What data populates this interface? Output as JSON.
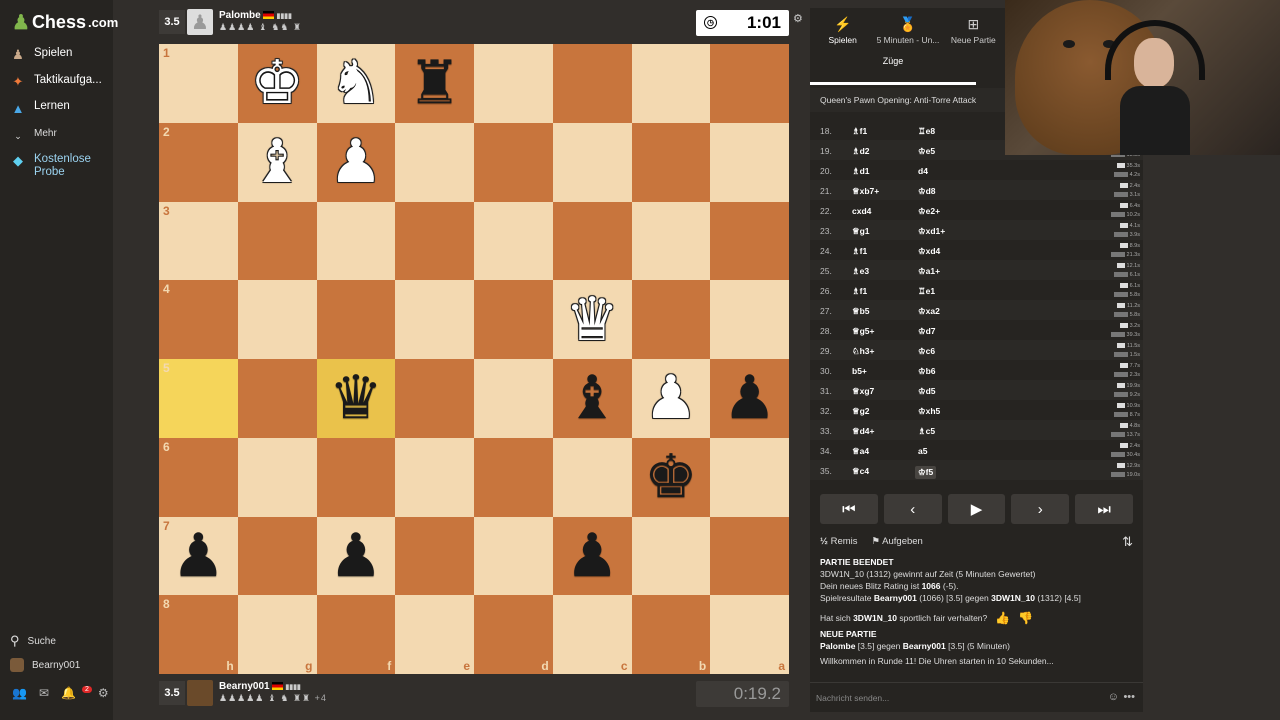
{
  "sidebar": {
    "logo": "Chess",
    "logo_suffix": ".com",
    "items": [
      {
        "label": "Spielen",
        "icon": "play-icon"
      },
      {
        "label": "Taktikaufga...",
        "icon": "puzzle-icon"
      },
      {
        "label": "Lernen",
        "icon": "learn-icon"
      },
      {
        "label": "Mehr",
        "icon": "chevron-down-icon"
      },
      {
        "label": "Kostenlose Probe",
        "icon": "diamond-icon"
      }
    ],
    "search_label": "Suche",
    "user_label": "Bearny001",
    "notification_count": "2"
  },
  "top_player": {
    "score": "3.5",
    "name": "Palombe",
    "captured": "♟♟♟♟ ♝ ♞♞ ♜",
    "clock": "1:01"
  },
  "bottom_player": {
    "score": "3.5",
    "name": "Bearny001",
    "captured": "♟♟♟♟♟ ♝ ♞ ♜♜",
    "material": "+4",
    "clock": "0:19.2"
  },
  "board": {
    "ranks": [
      "1",
      "2",
      "3",
      "4",
      "5",
      "6",
      "7",
      "8"
    ],
    "files": [
      "h",
      "g",
      "f",
      "e",
      "d",
      "c",
      "b",
      "a"
    ],
    "pieces": [
      [
        "",
        "wK",
        "wN",
        "bR",
        "",
        "",
        "",
        ""
      ],
      [
        "",
        "wB",
        "wP",
        "",
        "",
        "",
        "",
        ""
      ],
      [
        "",
        "",
        "",
        "",
        "",
        "",
        "",
        ""
      ],
      [
        "",
        "",
        "",
        "",
        "",
        "wQ",
        "",
        ""
      ],
      [
        "",
        "",
        "bQ",
        "",
        "",
        "bB",
        "wP",
        "bP"
      ],
      [
        "",
        "",
        "",
        "",
        "",
        "",
        "bK",
        ""
      ],
      [
        "bP",
        "",
        "bP",
        "",
        "",
        "bP",
        "",
        ""
      ],
      [
        "",
        "",
        "",
        "",
        "",
        "",
        "",
        ""
      ]
    ]
  },
  "panel": {
    "tabs": [
      {
        "label": "Spielen",
        "icon": "lightning-icon"
      },
      {
        "label": "5 Minuten - Un...",
        "icon": "medal-icon"
      },
      {
        "label": "Neue Partie",
        "icon": "plus-icon"
      }
    ],
    "subtab": "Züge",
    "opening": "Queen's Pawn Opening: Anti-Torre Attack",
    "moves": [
      {
        "no": "18.",
        "w": "♗f1",
        "b": "♖e8",
        "tw": "",
        "tb": ""
      },
      {
        "no": "19.",
        "w": "♗d2",
        "b": "♔e5",
        "tw": "5.6s",
        "tb": "15.8s"
      },
      {
        "no": "20.",
        "w": "♗d1",
        "b": "d4",
        "tw": "35.3s",
        "tb": "4.2s"
      },
      {
        "no": "21.",
        "w": "♕xb7+",
        "b": "♔d8",
        "tw": "2.4s",
        "tb": "3.1s"
      },
      {
        "no": "22.",
        "w": "cxd4",
        "b": "♔e2+",
        "tw": "6.4s",
        "tb": "10.2s"
      },
      {
        "no": "23.",
        "w": "♕g1",
        "b": "♔xd1+",
        "tw": "4.1s",
        "tb": "3.9s"
      },
      {
        "no": "24.",
        "w": "♗f1",
        "b": "♔xd4",
        "tw": "8.9s",
        "tb": "21.3s"
      },
      {
        "no": "25.",
        "w": "♗e3",
        "b": "♔a1+",
        "tw": "12.1s",
        "tb": "6.1s"
      },
      {
        "no": "26.",
        "w": "♗f1",
        "b": "♖e1",
        "tw": "6.1s",
        "tb": "5.8s"
      },
      {
        "no": "27.",
        "w": "♕b5",
        "b": "♔xa2",
        "tw": "11.2s",
        "tb": "5.8s"
      },
      {
        "no": "28.",
        "w": "♕g5+",
        "b": "♔d7",
        "tw": "3.2s",
        "tb": "39.3s"
      },
      {
        "no": "29.",
        "w": "♘h3+",
        "b": "♔c6",
        "tw": "11.5s",
        "tb": "1.5s"
      },
      {
        "no": "30.",
        "w": "b5+",
        "b": "♔b6",
        "tw": "7.7s",
        "tb": "2.3s"
      },
      {
        "no": "31.",
        "w": "♕xg7",
        "b": "♔d5",
        "tw": "19.9s",
        "tb": "9.2s"
      },
      {
        "no": "32.",
        "w": "♕g2",
        "b": "♔xh5",
        "tw": "10.9s",
        "tb": "8.7s"
      },
      {
        "no": "33.",
        "w": "♕d4+",
        "b": "♗c5",
        "tw": "4.8s",
        "tb": "13.7s"
      },
      {
        "no": "34.",
        "w": "♕a4",
        "b": "a5",
        "tw": "2.4s",
        "tb": "30.4s"
      },
      {
        "no": "35.",
        "w": "♕c4",
        "b": "♔f5",
        "tw": "12.9s",
        "tb": "19.0s"
      }
    ],
    "actions": {
      "draw": "Remis",
      "resign": "Aufgeben"
    },
    "log": {
      "over_title": "PARTIE BEENDET",
      "line1": "3DW1N_10 (1312) gewinnt auf Zeit (5 Minuten Gewertet)",
      "line2a": "Dein neues Blitz Rating ist ",
      "line2b": "1066",
      "line2c": " (-5).",
      "line3a": "Spielresultate ",
      "line3b": "Bearny001",
      "line3c": " (1066) [3.5] gegen ",
      "line3d": "3DW1N_10",
      "line3e": " (1312) [4.5]",
      "fair_a": "Hat sich ",
      "fair_b": "3DW1N_10",
      "fair_c": " sportlich fair verhalten?",
      "new_title": "NEUE PARTIE",
      "new_a": "Palombe",
      "new_b": " [3.5] gegen ",
      "new_c": "Bearny001",
      "new_d": " [3.5] (5 Minuten)",
      "welcome": "Willkommen in Runde 11! Die Uhren starten in 10 Sekunden..."
    },
    "chat_placeholder": "Nachricht senden..."
  }
}
